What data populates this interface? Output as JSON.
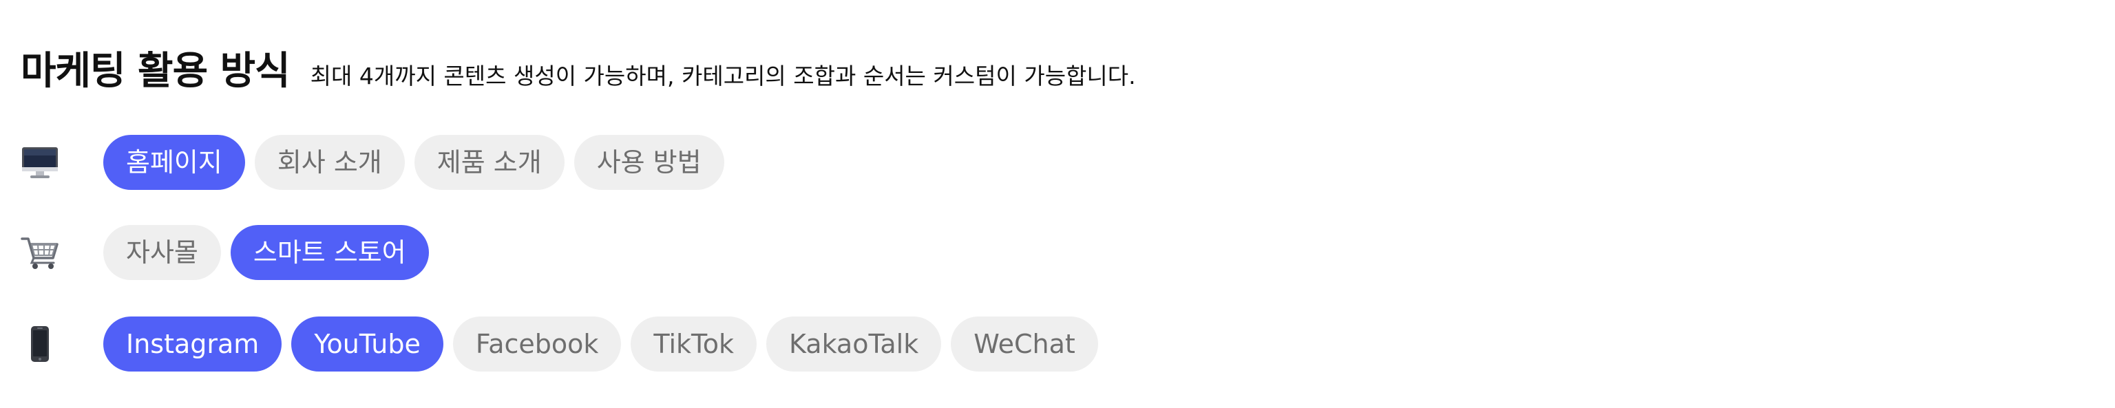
{
  "header": {
    "title": "마케팅 활용 방식",
    "description": "최대 4개까지 콘텐츠 생성이 가능하며, 카테고리의 조합과 순서는 커스텀이 가능합니다."
  },
  "rows": [
    {
      "icon": "desktop-computer-icon",
      "chips": [
        {
          "label": "홈페이지",
          "selected": true
        },
        {
          "label": "회사 소개",
          "selected": false
        },
        {
          "label": "제품 소개",
          "selected": false
        },
        {
          "label": "사용 방법",
          "selected": false
        }
      ]
    },
    {
      "icon": "shopping-cart-icon",
      "chips": [
        {
          "label": "자사몰",
          "selected": false
        },
        {
          "label": "스마트 스토어",
          "selected": true
        }
      ]
    },
    {
      "icon": "mobile-phone-icon",
      "chips": [
        {
          "label": "Instagram",
          "selected": true
        },
        {
          "label": "YouTube",
          "selected": true
        },
        {
          "label": "Facebook",
          "selected": false
        },
        {
          "label": "TikTok",
          "selected": false
        },
        {
          "label": "KakaoTalk",
          "selected": false
        },
        {
          "label": "WeChat",
          "selected": false
        }
      ]
    }
  ],
  "colors": {
    "selected_bg": "#5160f7",
    "selected_text": "#ffffff",
    "unselected_bg": "#efefef",
    "unselected_text": "#6e6e6e"
  }
}
